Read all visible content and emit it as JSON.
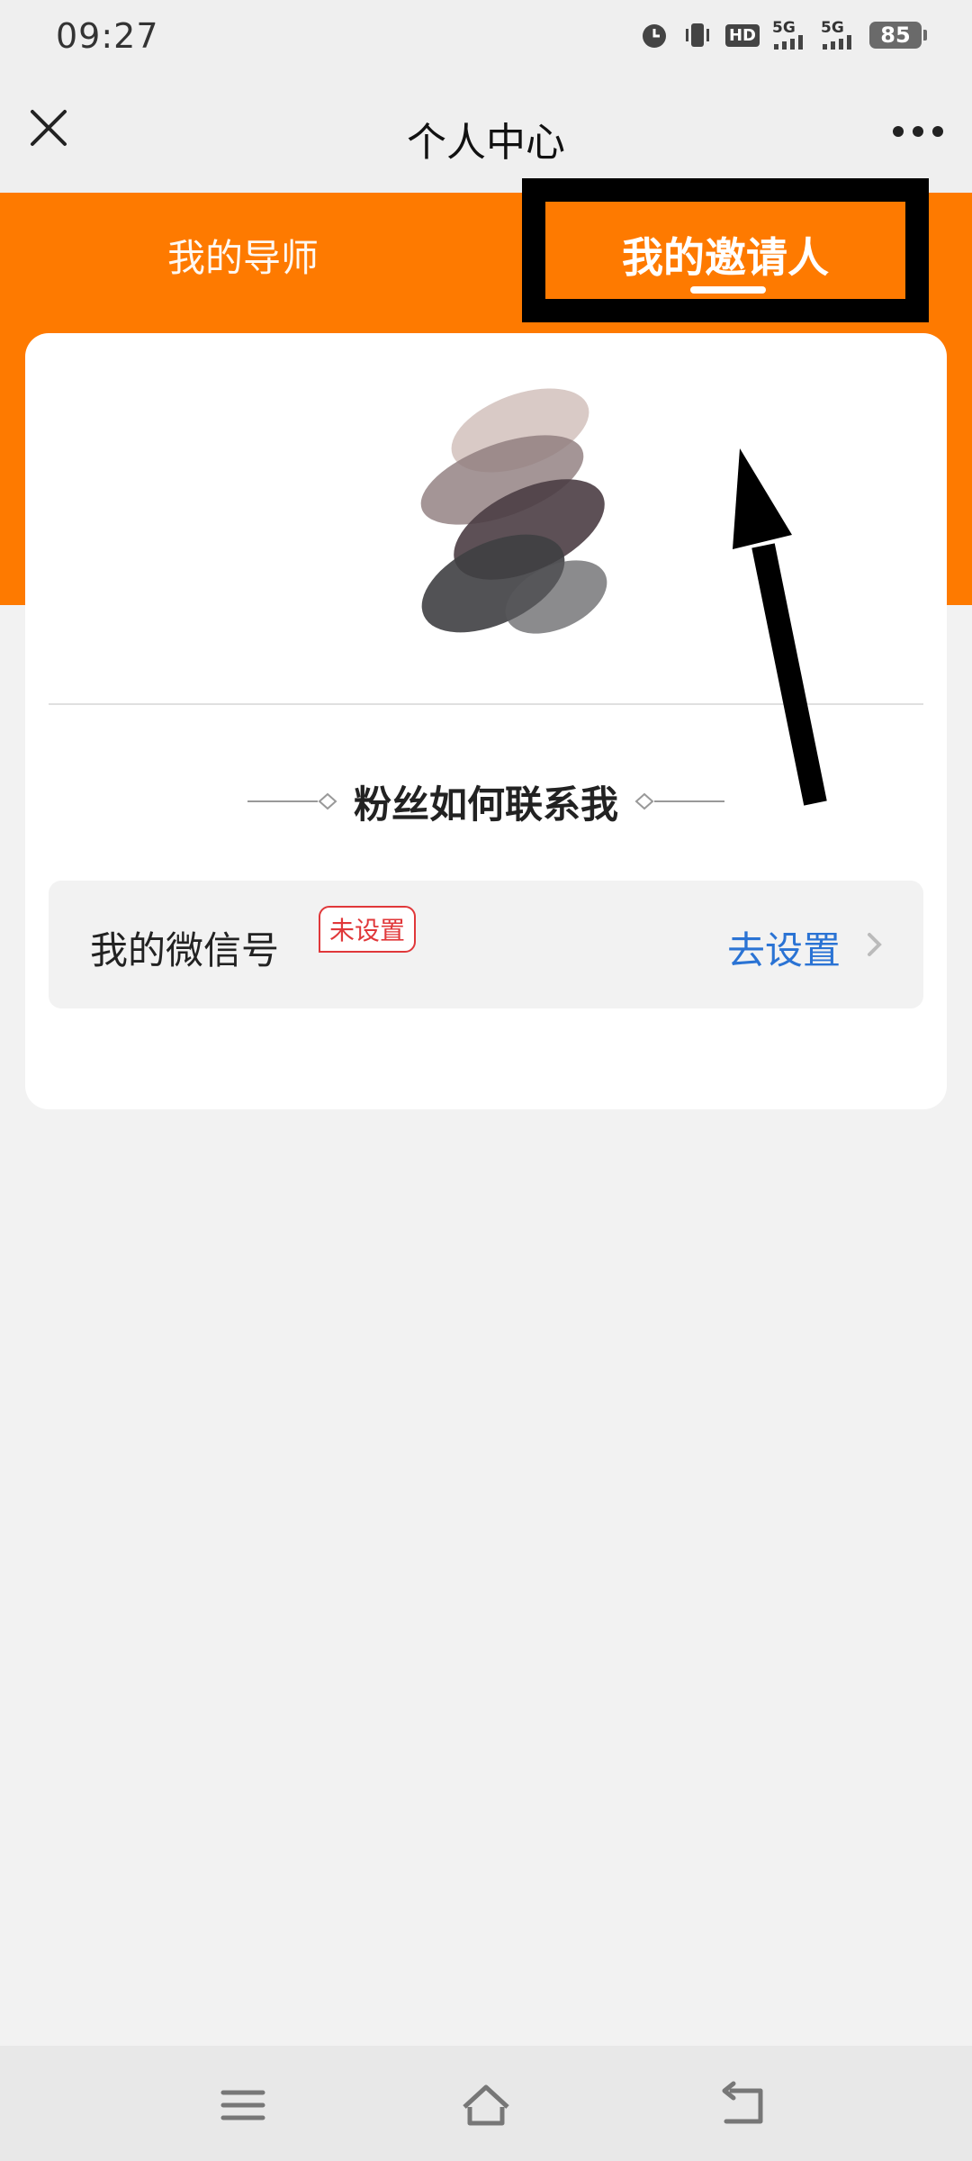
{
  "status_bar": {
    "time": "09:27",
    "battery": "85",
    "icons": [
      "alarm-icon",
      "vibrate-icon",
      "hd-icon",
      "signal-5g-icon",
      "signal-5g-icon",
      "battery-icon"
    ],
    "signal_1": "5G",
    "signal_2": "5G",
    "hd": "HD"
  },
  "nav": {
    "title": "个人中心",
    "close_icon": "close-icon",
    "more_icon": "more-icon"
  },
  "tabs": [
    {
      "label": "我的导师",
      "active": false
    },
    {
      "label": "我的邀请人",
      "active": true
    }
  ],
  "card": {
    "section_title": "粉丝如何联系我",
    "wechat": {
      "label": "我的微信号",
      "badge": "未设置",
      "action": "去设置"
    }
  },
  "colors": {
    "accent": "#fe7a00",
    "link": "#2a73d4",
    "badge": "#e0383a",
    "annotation": "#000000"
  },
  "bottom_nav": [
    "menu-icon",
    "home-icon",
    "back-icon"
  ]
}
